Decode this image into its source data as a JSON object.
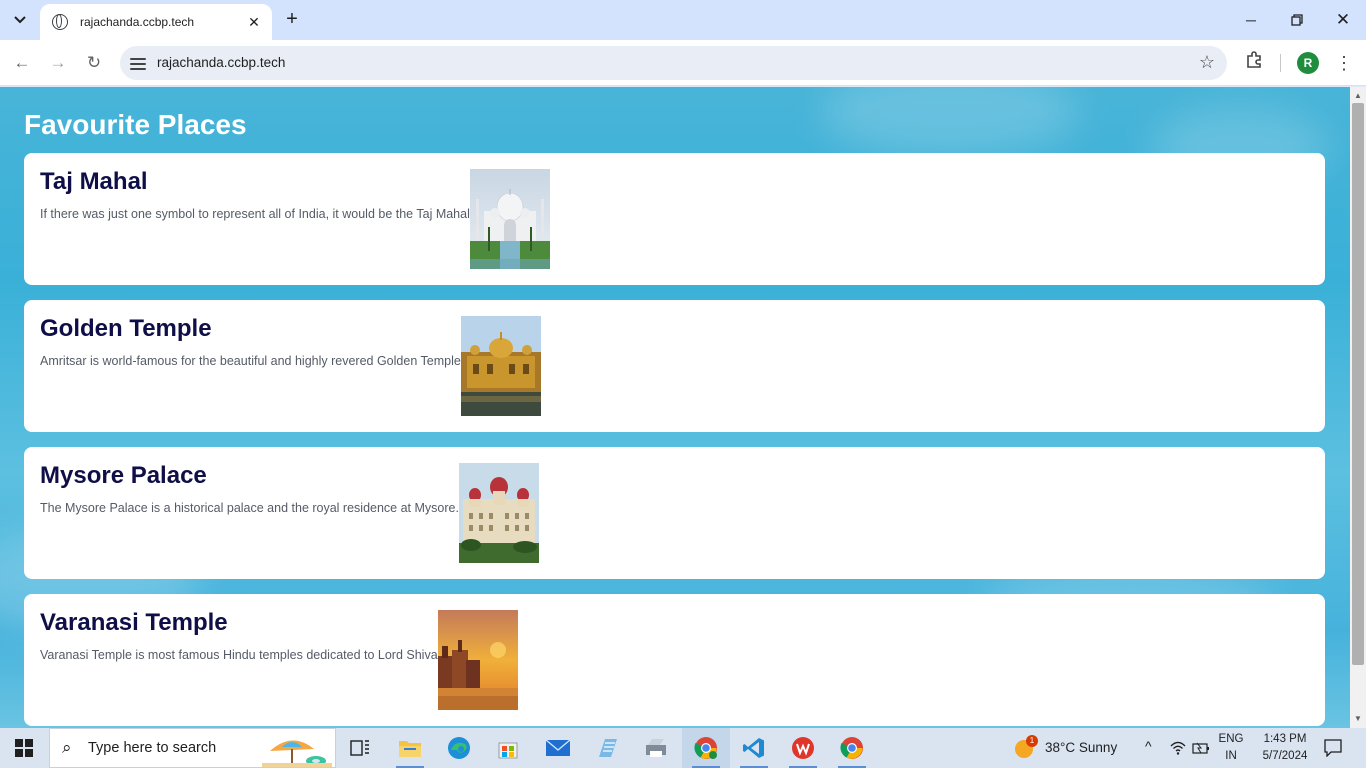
{
  "browser": {
    "tab_title": "rajachanda.ccbp.tech",
    "url": "rajachanda.ccbp.tech",
    "profile_initial": "R"
  },
  "page": {
    "title": "Favourite Places",
    "places": [
      {
        "name": "Taj Mahal",
        "description": "If there was just one symbol to represent all of India, it would be the Taj Mahal"
      },
      {
        "name": "Golden Temple",
        "description": "Amritsar is world-famous for the beautiful and highly revered Golden Temple"
      },
      {
        "name": "Mysore Palace",
        "description": "The Mysore Palace is a historical palace and the royal residence at Mysore."
      },
      {
        "name": "Varanasi Temple",
        "description": "Varanasi Temple is most famous Hindu temples dedicated to Lord Shiva"
      }
    ]
  },
  "taskbar": {
    "search_placeholder": "Type here to search",
    "weather": "38°C  Sunny",
    "weather_badge": "1",
    "language": "ENG",
    "region": "IN",
    "time": "1:43 PM",
    "date": "5/7/2024"
  },
  "colors": {
    "accent_blue": "#3ab0d8",
    "card_title": "#0f0e46",
    "card_text": "#555b66"
  }
}
